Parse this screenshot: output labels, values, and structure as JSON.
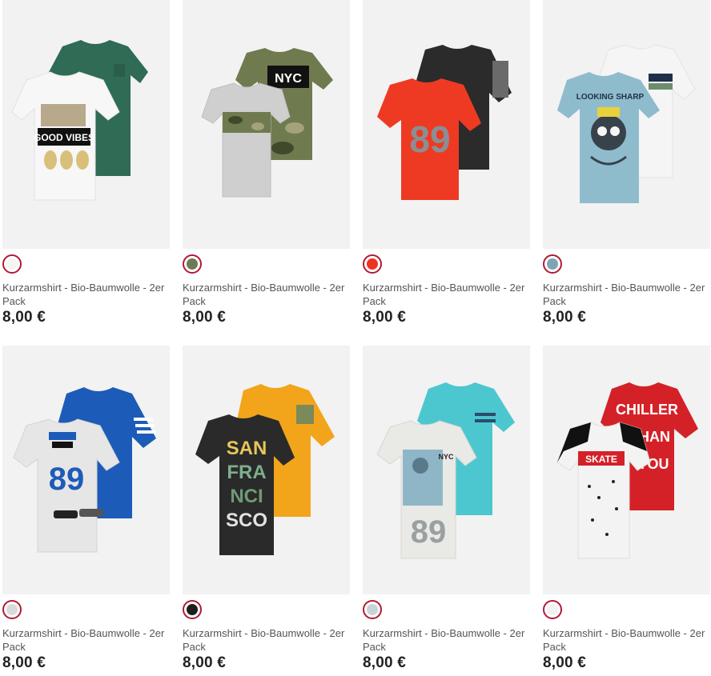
{
  "products": [
    {
      "title": "Kurzarmshirt - Bio-Baumwolle - 2er Pack",
      "price": "8,00 €",
      "swatch": "#f4f4f4",
      "icon": "tshirt-2pack-white-green",
      "back_color": "#2f6b55",
      "front_color": "#f7f7f7",
      "print_text": "GOOD VIBES"
    },
    {
      "title": "Kurzarmshirt - Bio-Baumwolle - 2er Pack",
      "price": "8,00 €",
      "swatch": "#6f7a55",
      "icon": "tshirt-2pack-camo-grey",
      "back_color": "#6f7a4f",
      "front_color": "#cfcfcf",
      "print_text": "NYC"
    },
    {
      "title": "Kurzarmshirt - Bio-Baumwolle - 2er Pack",
      "price": "8,00 €",
      "swatch": "#ee3322",
      "icon": "tshirt-2pack-red-black",
      "back_color": "#2b2b2b",
      "front_color": "#ee3a22",
      "print_text": "89"
    },
    {
      "title": "Kurzarmshirt - Bio-Baumwolle - 2er Pack",
      "price": "8,00 €",
      "swatch": "#7fa3b2",
      "icon": "tshirt-2pack-lightblue-white",
      "back_color": "#f5f5f5",
      "front_color": "#8fbccc",
      "print_text": "LOOKING SHARP"
    },
    {
      "title": "Kurzarmshirt - Bio-Baumwolle - 2er Pack",
      "price": "8,00 €",
      "swatch": "#dadada",
      "icon": "tshirt-2pack-grey-blue",
      "back_color": "#1d5bb8",
      "front_color": "#e6e6e6",
      "print_text": "89"
    },
    {
      "title": "Kurzarmshirt - Bio-Baumwolle - 2er Pack",
      "price": "8,00 €",
      "swatch": "#1e1e1e",
      "icon": "tshirt-2pack-black-yellow",
      "back_color": "#f2a51b",
      "front_color": "#2a2a2a",
      "print_text": "SAN FRANCISCO"
    },
    {
      "title": "Kurzarmshirt - Bio-Baumwolle - 2er Pack",
      "price": "8,00 €",
      "swatch": "#c9d3d6",
      "icon": "tshirt-2pack-grey-turquoise",
      "back_color": "#4cc7cf",
      "front_color": "#e9e9e6",
      "print_text": "NYC"
    },
    {
      "title": "Kurzarmshirt - Bio-Baumwolle - 2er Pack",
      "price": "8,00 €",
      "swatch": "#f2f2f2",
      "icon": "tshirt-2pack-speckled-red",
      "back_color": "#d42128",
      "front_color": "#f3f3f3",
      "print_text": "SKATE"
    }
  ]
}
